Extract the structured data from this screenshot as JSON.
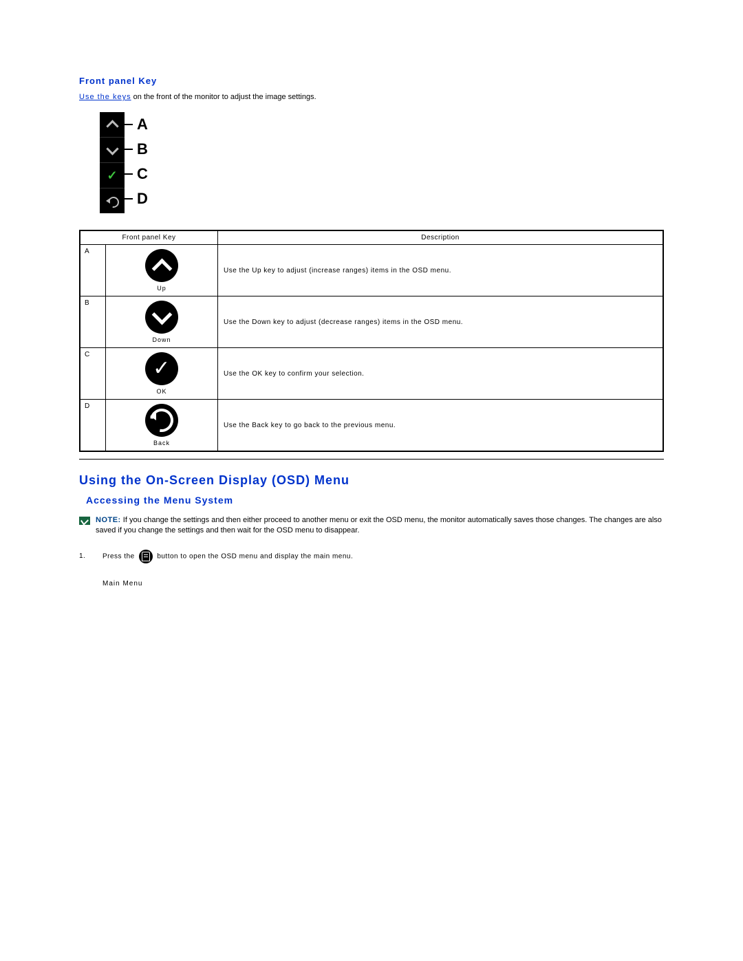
{
  "front_panel": {
    "title": "Front panel Key",
    "link_text": "Use the keys",
    "intro_tail": " on the front of the monitor to adjust the image settings.",
    "labels": [
      "A",
      "B",
      "C",
      "D"
    ]
  },
  "table": {
    "col_key": "Front panel Key",
    "col_desc": "Description",
    "rows": [
      {
        "letter": "A",
        "caption": "Up",
        "desc": "Use the Up key to adjust (increase ranges) items in the OSD menu."
      },
      {
        "letter": "B",
        "caption": "Down",
        "desc": "Use the Down key to adjust (decrease ranges) items in the OSD menu."
      },
      {
        "letter": "C",
        "caption": "OK",
        "desc": "Use the OK key to confirm your selection."
      },
      {
        "letter": "D",
        "caption": "Back",
        "desc": "Use the Back key to go back to the previous menu."
      }
    ]
  },
  "osd": {
    "title": "Using the On-Screen Display (OSD) Menu",
    "subtitle": "Accessing the Menu System",
    "note_lead": "NOTE:",
    "note_body": " If you change the settings and then either proceed to another menu or exit the OSD menu, the monitor automatically saves those changes. The changes are also saved if you change the settings and then wait for the OSD menu to disappear.",
    "step_num": "1.",
    "step_pre": "Press the ",
    "step_post": " button to open the OSD menu and display the main menu.",
    "main_menu": "Main Menu"
  }
}
